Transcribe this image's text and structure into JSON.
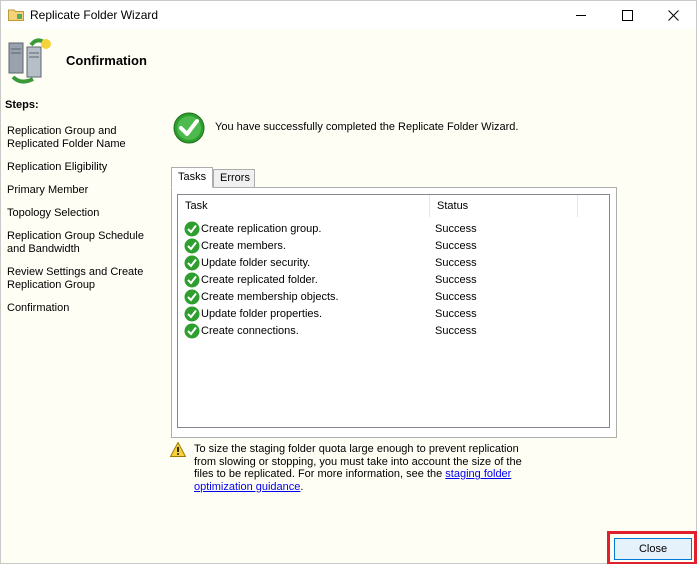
{
  "window": {
    "title": "Replicate Folder Wizard",
    "controls": {
      "minimize": "minimize-icon",
      "maximize": "maximize-icon",
      "close": "close-icon"
    }
  },
  "header": {
    "title": "Confirmation",
    "icon": "replication-servers-icon"
  },
  "steps": {
    "title": "Steps:",
    "items": [
      {
        "label": "Replication Group and Replicated Folder Name"
      },
      {
        "label": "Replication Eligibility"
      },
      {
        "label": "Primary Member"
      },
      {
        "label": "Topology Selection"
      },
      {
        "label": "Replication Group Schedule and Bandwidth"
      },
      {
        "label": "Review Settings and Create Replication Group"
      },
      {
        "label": "Confirmation"
      }
    ]
  },
  "result": {
    "message": "You have successfully completed the Replicate Folder Wizard.",
    "icon": "success-check-icon"
  },
  "tabs": [
    {
      "label": "Tasks",
      "active": true
    },
    {
      "label": "Errors",
      "active": false
    }
  ],
  "grid": {
    "columns": [
      "Task",
      "Status"
    ],
    "rows": [
      {
        "task": "Create replication group.",
        "status": "Success"
      },
      {
        "task": "Create members.",
        "status": "Success"
      },
      {
        "task": "Update folder security.",
        "status": "Success"
      },
      {
        "task": "Create replicated folder.",
        "status": "Success"
      },
      {
        "task": "Create membership objects.",
        "status": "Success"
      },
      {
        "task": "Update folder properties.",
        "status": "Success"
      },
      {
        "task": "Create connections.",
        "status": "Success"
      }
    ]
  },
  "warning": {
    "icon": "warning-icon",
    "line1": "To size the staging folder quota large enough to prevent replication",
    "line2": "from slowing or stopping, you must take into account the size of the",
    "line3": "files to be replicated. For more information, see the ",
    "link_part1": "staging folder",
    "link_part2": "optimization guidance",
    "end": "."
  },
  "footer": {
    "close_label": "Close"
  },
  "colors": {
    "highlight": "#e0202a",
    "success_green": "#2e9e2e",
    "link": "#0000ee"
  }
}
